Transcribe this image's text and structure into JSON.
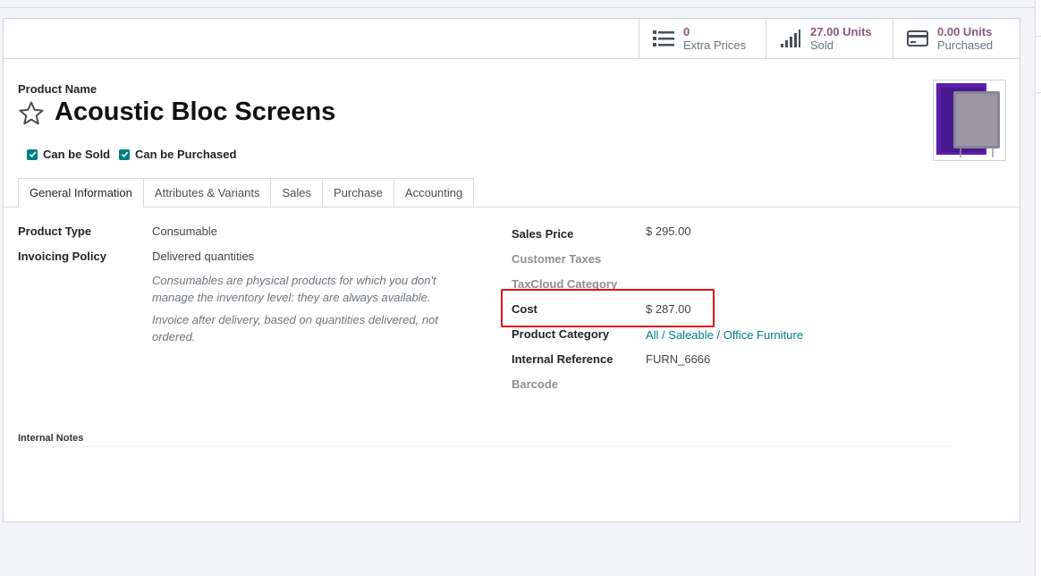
{
  "stats": {
    "extra_prices": {
      "value": "0",
      "label": "Extra Prices",
      "icon": "list-icon"
    },
    "sold": {
      "value": "27.00 Units",
      "label": "Sold",
      "icon": "signal-bars-icon"
    },
    "purchased": {
      "value": "0.00 Units",
      "label": "Purchased",
      "icon": "credit-card-icon"
    }
  },
  "product": {
    "name_label": "Product Name",
    "name": "Acoustic Bloc Screens",
    "can_be_sold_label": "Can be Sold",
    "can_be_purchased_label": "Can be Purchased"
  },
  "tabs": [
    {
      "label": "General Information",
      "active": true
    },
    {
      "label": "Attributes & Variants"
    },
    {
      "label": "Sales"
    },
    {
      "label": "Purchase"
    },
    {
      "label": "Accounting"
    }
  ],
  "general": {
    "product_type_label": "Product Type",
    "product_type_value": "Consumable",
    "invoicing_policy_label": "Invoicing Policy",
    "invoicing_policy_value": "Delivered quantities",
    "help_product_type": "Consumables are physical products for which you don't manage the inventory level: they are always available.",
    "help_invoicing": "Invoice after delivery, based on quantities delivered, not ordered.",
    "sales_price_label": "Sales Price",
    "sales_price_value": "$ 295.00",
    "customer_taxes_label": "Customer Taxes",
    "taxcloud_label": "TaxCloud Category",
    "cost_label": "Cost",
    "cost_value": "$ 287.00",
    "category_label": "Product Category",
    "category_value": "All / Saleable / Office Furniture",
    "internal_ref_label": "Internal Reference",
    "internal_ref_value": "FURN_6666",
    "barcode_label": "Barcode",
    "internal_notes_label": "Internal Notes"
  },
  "colors": {
    "accent": "#017e84",
    "stat_value": "#875a7b",
    "highlight": "#e0121b"
  }
}
